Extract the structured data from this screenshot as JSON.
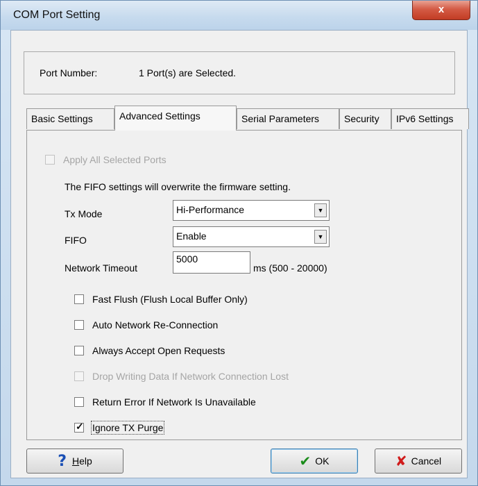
{
  "window": {
    "title": "COM Port Setting",
    "close_symbol": "x"
  },
  "port": {
    "label": "Port Number:",
    "value": "1 Port(s) are Selected."
  },
  "tabs": [
    {
      "label": "Basic Settings",
      "active": false
    },
    {
      "label": "Advanced Settings",
      "active": true
    },
    {
      "label": "Serial Parameters",
      "active": false
    },
    {
      "label": "Security",
      "active": false
    },
    {
      "label": "IPv6 Settings",
      "active": false
    }
  ],
  "advanced": {
    "apply_all": {
      "label": "Apply All Selected Ports",
      "checked": false,
      "enabled": false
    },
    "fifo_note": "The FIFO settings will overwrite the firmware setting.",
    "tx_mode": {
      "label": "Tx Mode",
      "value": "Hi-Performance"
    },
    "fifo": {
      "label": "FIFO",
      "value": "Enable"
    },
    "network_timeout": {
      "label": "Network Timeout",
      "value": "5000",
      "unit": "ms (500 - 20000)"
    },
    "options": [
      {
        "label": "Fast Flush (Flush Local Buffer Only)",
        "checked": false,
        "enabled": true
      },
      {
        "label": "Auto Network Re-Connection",
        "checked": false,
        "enabled": true
      },
      {
        "label": "Always Accept Open Requests",
        "checked": false,
        "enabled": true
      },
      {
        "label": "Drop Writing Data If Network Connection Lost",
        "checked": false,
        "enabled": false
      },
      {
        "label": "Return Error If Network Is Unavailable",
        "checked": false,
        "enabled": true
      },
      {
        "label": "Ignore TX Purge",
        "checked": true,
        "enabled": true
      }
    ]
  },
  "buttons": {
    "help": "Help",
    "ok": "OK",
    "cancel": "Cancel"
  },
  "icons": {
    "help": "question-mark-icon",
    "ok": "check-icon",
    "cancel": "x-icon"
  },
  "colors": {
    "title_bar": "#c7dbee",
    "close_button": "#c23c24",
    "help_icon": "#1a4fb5",
    "ok_icon": "#1b8c1b",
    "cancel_icon": "#d01b1b"
  }
}
